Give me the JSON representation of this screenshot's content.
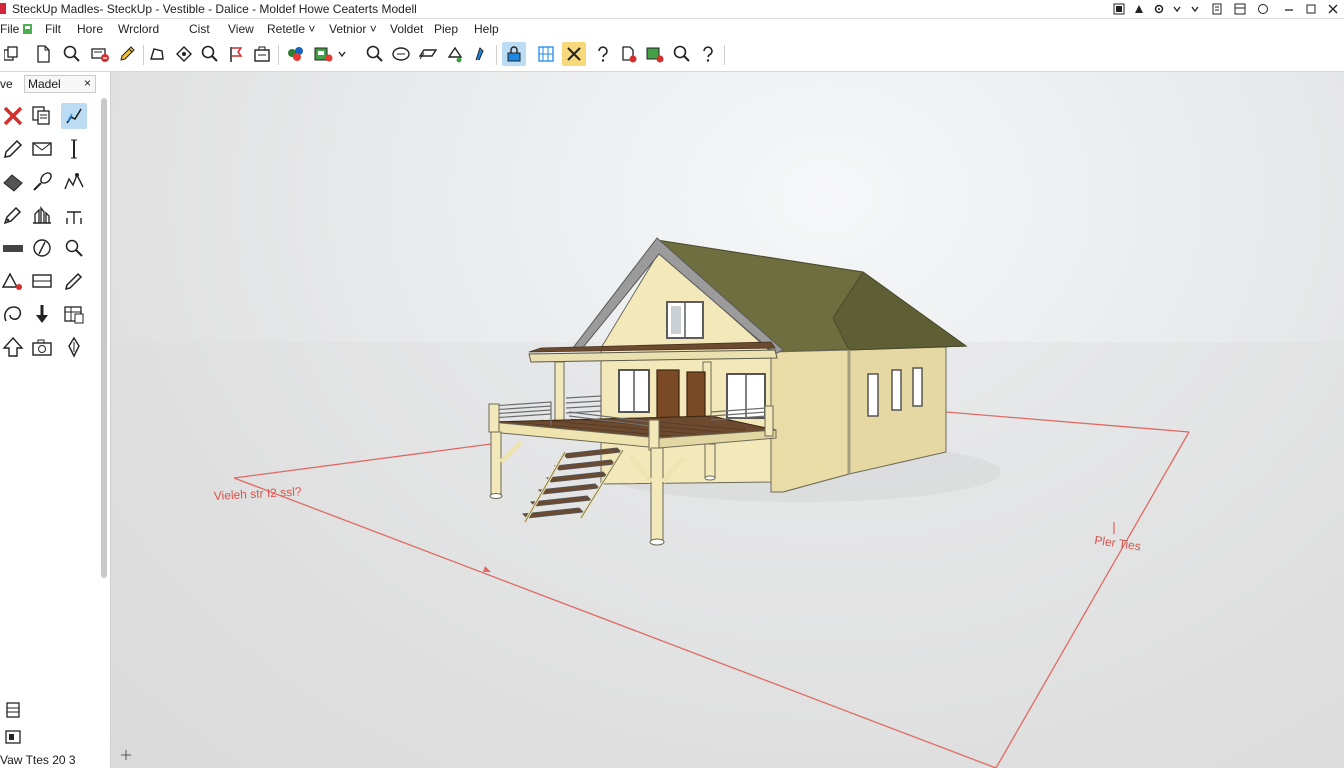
{
  "window": {
    "title": "SteckUp Madles- SteckUp - Vestible - Dalice - Moldef Howe Ceaterts Modell"
  },
  "menu": [
    {
      "label": "File"
    },
    {
      "label": "Filt"
    },
    {
      "label": "Hore"
    },
    {
      "label": "Wrclord"
    },
    {
      "label": "Cist"
    },
    {
      "label": "View"
    },
    {
      "label": "Retetle ˅"
    },
    {
      "label": "Vetnior ˅"
    },
    {
      "label": "Voldet"
    },
    {
      "label": "Piep"
    },
    {
      "label": "Help"
    }
  ],
  "panel": {
    "tab_left": "ve",
    "tab_label": "Madel",
    "close_glyph": "×",
    "status": "Vaw   Ttes 20 3"
  },
  "scene": {
    "annotation_left": "Vieleh str I2 ssl?",
    "annotation_right": "Pler Ties",
    "colors": {
      "wall": "#f1e6b5",
      "roof": "#6e6e3e",
      "deck": "#6b4a30",
      "axis": "#e06a63"
    }
  },
  "colors": {
    "accent_blue": "#bcdcf3",
    "accent_yellow": "#f7d97c",
    "app_red": "#d4263b"
  }
}
